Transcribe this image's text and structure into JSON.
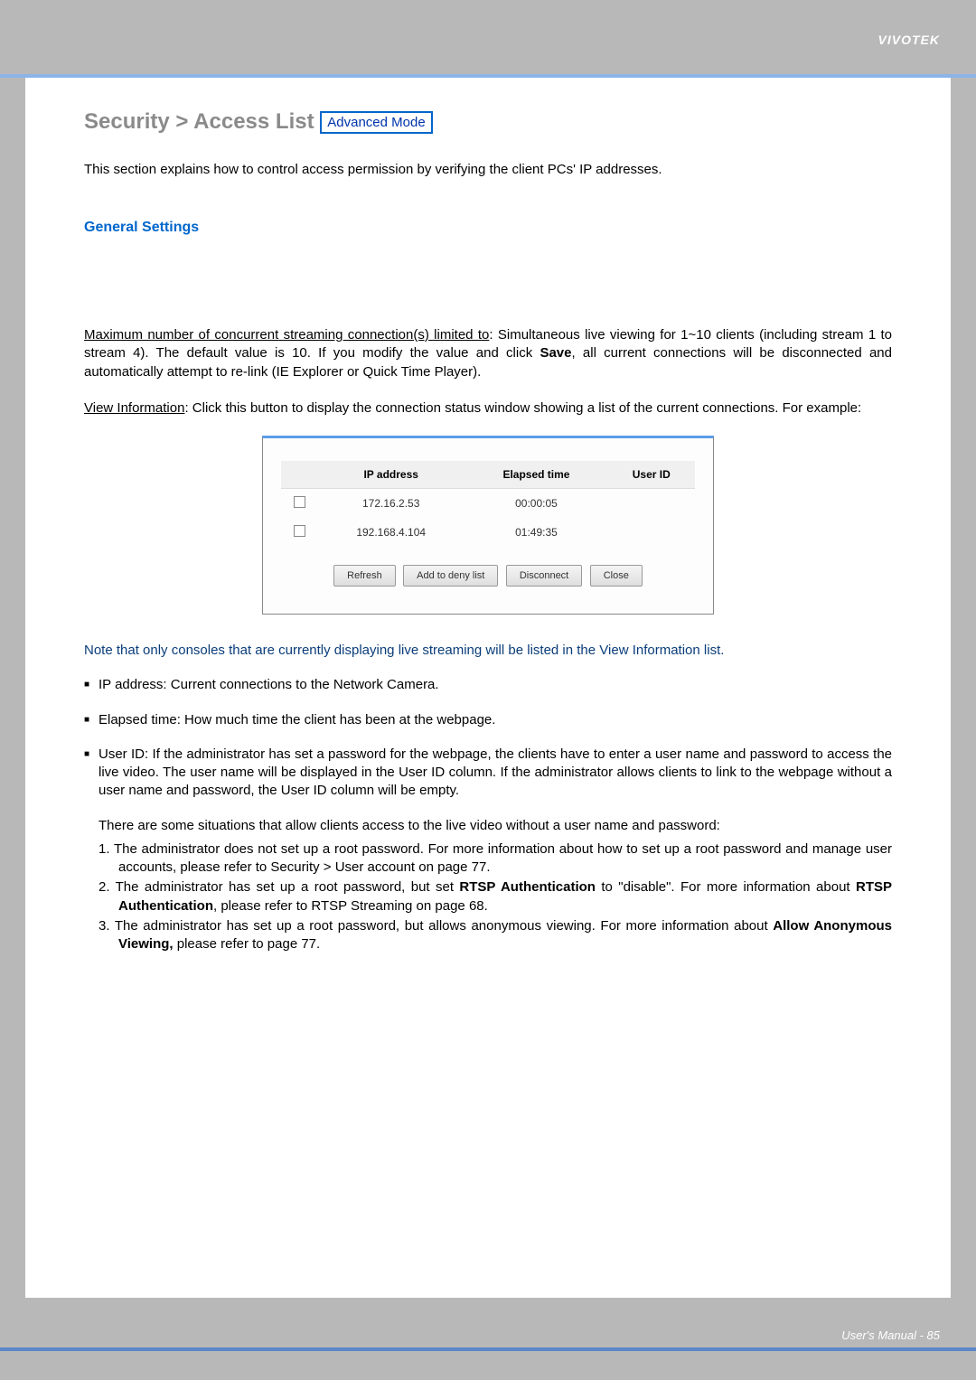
{
  "brand": "VIVOTEK",
  "section": {
    "title_prefix": "Security >  Access List",
    "badge": "Advanced Mode"
  },
  "intro": "This section explains how to control access permission by verifying the client PCs' IP addresses.",
  "subheading": "General Settings",
  "para_max_label": "Maximum number of concurrent streaming connection(s) limited to",
  "para_max_rest": ": Simultaneous live viewing for 1~10 clients (including stream 1 to stream 4). The default value is 10. If you modify the value and click ",
  "para_max_save": "Save",
  "para_max_tail": ", all current connections will be disconnected and automatically attempt to re-link (IE Explorer or Quick Time Player).",
  "para_view_label": "View Information",
  "para_view_rest": ": Click this button to display the connection status window showing a list of the current connections. For example:",
  "dialog": {
    "headers": {
      "ip": "IP address",
      "elapsed": "Elapsed time",
      "user": "User ID"
    },
    "rows": [
      {
        "ip": "172.16.2.53",
        "elapsed": "00:00:05",
        "user": ""
      },
      {
        "ip": "192.168.4.104",
        "elapsed": "01:49:35",
        "user": ""
      }
    ],
    "buttons": {
      "refresh": "Refresh",
      "add_deny": "Add to deny list",
      "disconnect": "Disconnect",
      "close": "Close"
    }
  },
  "note": "Note that only consoles that are currently displaying live streaming will be listed in the View Information list.",
  "bullets": {
    "ip": "IP address: Current connections to the Network Camera.",
    "elapsed": "Elapsed time: How much time the client has been at the webpage.",
    "userid": "User ID: If the administrator has set a password for the webpage, the clients have to enter a user name and password to access the live video. The user name will be displayed in the User ID column. If  the administrator allows clients to link to the webpage without a user name and password, the User ID column will be empty."
  },
  "situations_intro": "There are some situations that allow clients access to the live video without a user name and password:",
  "situations": {
    "s1_a": "1. The administrator does not set up a root password. For more information about how to set up a root password and manage user accounts, please refer to Security > User account on page 77.",
    "s2_a": "2. The administrator has set up a root password, but set ",
    "s2_b": "RTSP Authentication",
    "s2_c": " to \"disable\". For more information about ",
    "s2_d": "RTSP Authentication",
    "s2_e": ", please refer to RTSP Streaming on page 68.",
    "s3_a": "3. The administrator has set up a root password, but allows anonymous viewing. For more information about ",
    "s3_b": "Allow Anonymous Viewing,",
    "s3_c": " please refer to page 77."
  },
  "footer": "User's Manual - 85"
}
